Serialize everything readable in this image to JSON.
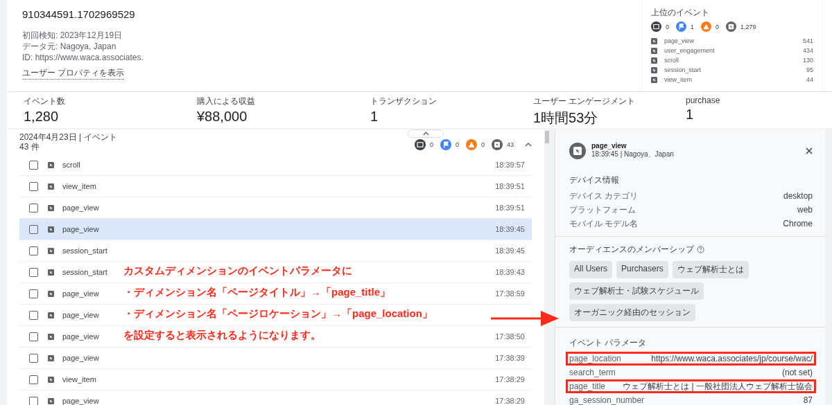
{
  "user": {
    "id": "910344591.1702969529",
    "details": [
      "初回検知: 2023年12月19日",
      "データ元: Nagoya, Japan",
      "ID: https://www.waca.associates."
    ],
    "link": "ユーザー プロパティを表示"
  },
  "top_events": {
    "title": "上位のイベント",
    "counts": [
      {
        "kind": "conversion",
        "count": "0"
      },
      {
        "kind": "flag",
        "count": "1"
      },
      {
        "kind": "warning",
        "count": "0"
      },
      {
        "kind": "event",
        "count": "1,279"
      }
    ],
    "items": [
      {
        "name": "page_view",
        "count": "541"
      },
      {
        "name": "user_engagement",
        "count": "434"
      },
      {
        "name": "scroll",
        "count": "130"
      },
      {
        "name": "session_start",
        "count": "95"
      },
      {
        "name": "view_item",
        "count": "44"
      }
    ]
  },
  "metrics": [
    {
      "label": "イベント数",
      "value": "1,280"
    },
    {
      "label": "購入による収益",
      "value": "¥88,000"
    },
    {
      "label": "トランザクション",
      "value": "1"
    },
    {
      "label": "ユーザー エンゲージメント",
      "value": "1時間53分"
    },
    {
      "label": "purchase",
      "value": "1"
    }
  ],
  "timeline": {
    "header": "2024年4月23日 | イベント 43 件",
    "expanded": true,
    "counts": [
      {
        "kind": "conversion",
        "count": "0"
      },
      {
        "kind": "flag",
        "count": "0"
      },
      {
        "kind": "warning",
        "count": "0"
      },
      {
        "kind": "event",
        "count": "43"
      }
    ],
    "rows": [
      {
        "name": "scroll",
        "time": "18:39:57",
        "checked": false,
        "selected": false
      },
      {
        "name": "view_item",
        "time": "18:39:51",
        "checked": false,
        "selected": false
      },
      {
        "name": "page_view",
        "time": "18:39:51",
        "checked": false,
        "selected": false
      },
      {
        "name": "page_view",
        "time": "18:39:45",
        "checked": false,
        "selected": true
      },
      {
        "name": "session_start",
        "time": "18:39:45",
        "checked": false,
        "selected": false
      },
      {
        "name": "session_start",
        "time": "18:39:43",
        "checked": false,
        "selected": false
      },
      {
        "name": "page_view",
        "time": "17:38:59",
        "checked": false,
        "selected": false
      },
      {
        "name": "page_view",
        "checked": false,
        "selected": false
      },
      {
        "name": "page_view",
        "time": "17:38:50",
        "checked": false,
        "selected": false
      },
      {
        "name": "page_view",
        "time": "17:38:39",
        "checked": false,
        "selected": false
      },
      {
        "name": "view_item",
        "time": "17:38:29",
        "checked": false,
        "selected": false
      },
      {
        "name": "page_view",
        "time": "17:38:29",
        "checked": false,
        "selected": false
      }
    ]
  },
  "detail": {
    "title": "page_view",
    "subtitle": "18:39:45 | Nagoya、Japan",
    "device": {
      "heading": "デバイス情報",
      "rows": [
        {
          "label": "デバイス カテゴリ",
          "value": "desktop"
        },
        {
          "label": "プラットフォーム",
          "value": "web"
        },
        {
          "label": "モバイル モデル名",
          "value": "Chrome"
        }
      ]
    },
    "audience": {
      "heading": "オーディエンスのメンバーシップ",
      "chips": [
        "All Users",
        "Purchasers",
        "ウェブ解析士とは",
        "ウェブ解析士・試験スケジュール",
        "オーガニック経由のセッション"
      ]
    },
    "params": {
      "heading": "イベント パラメータ",
      "rows": [
        {
          "label": "page_location",
          "value": "https://www.waca.associates/jp/course/wac/",
          "highlighted": true
        },
        {
          "label": "search_term",
          "value": "(not set)",
          "highlighted": false
        },
        {
          "label": "page_title",
          "value": "ウェブ解析士とは | 一般社団法人ウェブ解析士協会",
          "highlighted": true
        },
        {
          "label": "ga_session_number",
          "value": "87",
          "highlighted": false
        }
      ]
    }
  },
  "annotation": {
    "heading": "カスタムディメンションのイベントパラメータに",
    "bullets": [
      "・ディメンション名「ページタイトル」→「page_title」",
      "・ディメンション名「ページロケーション」→「page_location」"
    ],
    "footer": "を設定すると表示されるようになります。"
  }
}
